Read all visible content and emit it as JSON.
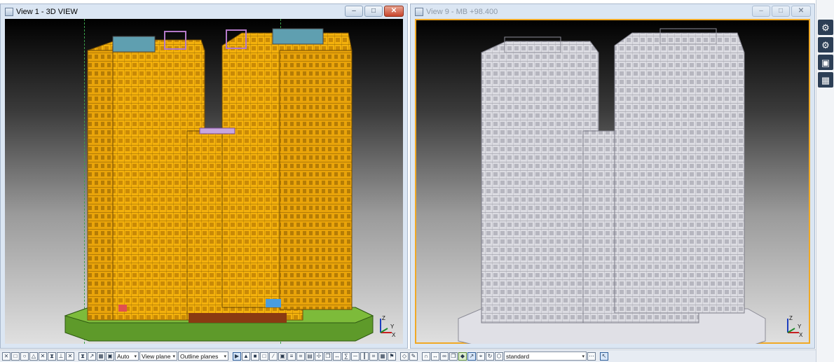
{
  "colors": {
    "accent": "#f0a925",
    "building_yellow": "#f4b10c",
    "building_green": "#5e9a2a",
    "building_white": "#e8e8ee"
  },
  "windows": [
    {
      "title": "View 1 - 3D VIEW",
      "minimize_icon": "minimize-icon",
      "restore_icon": "restore-icon",
      "close_icon": "close-icon",
      "axis": {
        "z": "Z",
        "x": "X",
        "y": "Y"
      }
    },
    {
      "title": "View 9 - MB +98.400",
      "minimize_icon": "minimize-icon",
      "restore_icon": "restore-icon",
      "close_icon": "close-icon",
      "axis": {
        "z": "Z",
        "x": "X",
        "y": "Y"
      }
    }
  ],
  "sidebar": {
    "items": [
      {
        "icon": "gear-link-icon"
      },
      {
        "icon": "gear-icon"
      },
      {
        "icon": "cube-icon"
      },
      {
        "icon": "components-icon"
      }
    ]
  },
  "toolbar": {
    "selects": [
      {
        "value": "Auto"
      },
      {
        "value": "View plane"
      },
      {
        "value": "Outline planes"
      },
      {
        "value": "standard"
      }
    ]
  }
}
